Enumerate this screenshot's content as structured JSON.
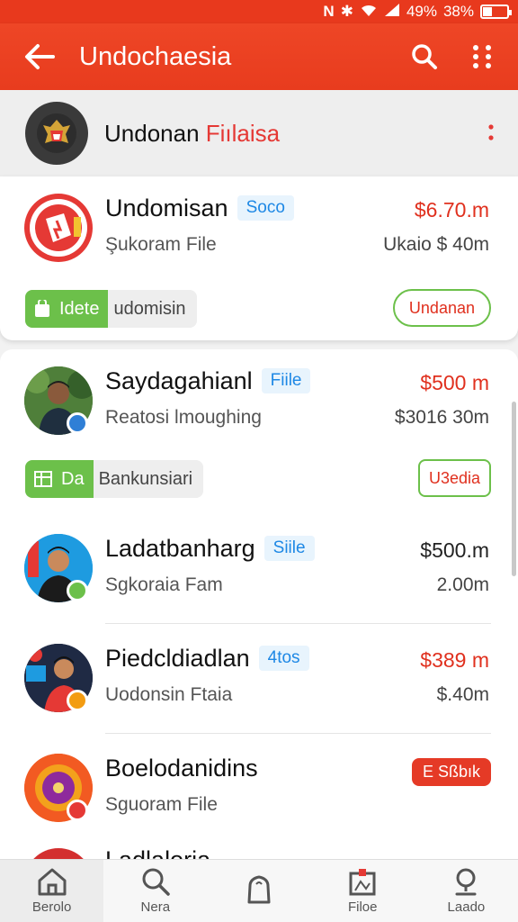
{
  "status_bar": {
    "network": "N",
    "bluetooth": "✱",
    "wifi": "wifi-icon",
    "signal": "signal-icon",
    "sim_percent": "49%",
    "battery_percent": "38%",
    "battery_level": 0.38
  },
  "app_bar": {
    "back_icon": "arrow-left-icon",
    "title": "Undochaesia",
    "search_icon": "search-icon",
    "more_icon": "more-vert-icon"
  },
  "group": {
    "name_main": "Undonan ",
    "name_accent": "Fiılaisa",
    "more_icon": "more-vert-icon"
  },
  "items": [
    {
      "title": "Undomisan",
      "tag": "Soco",
      "subtitle": "Şukoram File",
      "price": "$6.70.m",
      "subprice": "Ukaio $ 40m",
      "action_chip": "udomisin",
      "action_chip_icon_text": "Idete",
      "action_button": "Undanan"
    },
    {
      "title": "Saydagahianl",
      "tag": "Fiile",
      "subtitle": "Reatosi lmoughing",
      "price": "$500 m",
      "subprice": "$3016 30m",
      "action_chip": "Bankunsiari",
      "action_chip_icon_text": "Da",
      "action_button": "U3edia"
    },
    {
      "title": "Ladatbanharg",
      "tag": "Siile",
      "subtitle": "Sgkoraia Fam",
      "price": "$500.m",
      "subprice": "2.00m"
    },
    {
      "title": "Piedcldiadlan",
      "tag": "4tos",
      "subtitle": "Uodonsin Ftaia",
      "price": "$389 m",
      "subprice": "$.40m"
    },
    {
      "title": "Boelodanidins",
      "subtitle": "Sguoram File",
      "badge": "E Sßbık"
    },
    {
      "title": "Ladlaloria"
    }
  ],
  "bottom_nav": [
    {
      "label": "Berolo",
      "icon": "home-icon"
    },
    {
      "label": "Nera",
      "icon": "search-icon"
    },
    {
      "label": "",
      "icon": "bag-icon"
    },
    {
      "label": "Filoe",
      "icon": "file-icon"
    },
    {
      "label": "Laado",
      "icon": "profile-icon"
    }
  ],
  "colors": {
    "primary": "#e8391d",
    "accent_red": "#e0301e",
    "green": "#6cc04a",
    "tag_blue": "#1e88e5"
  }
}
